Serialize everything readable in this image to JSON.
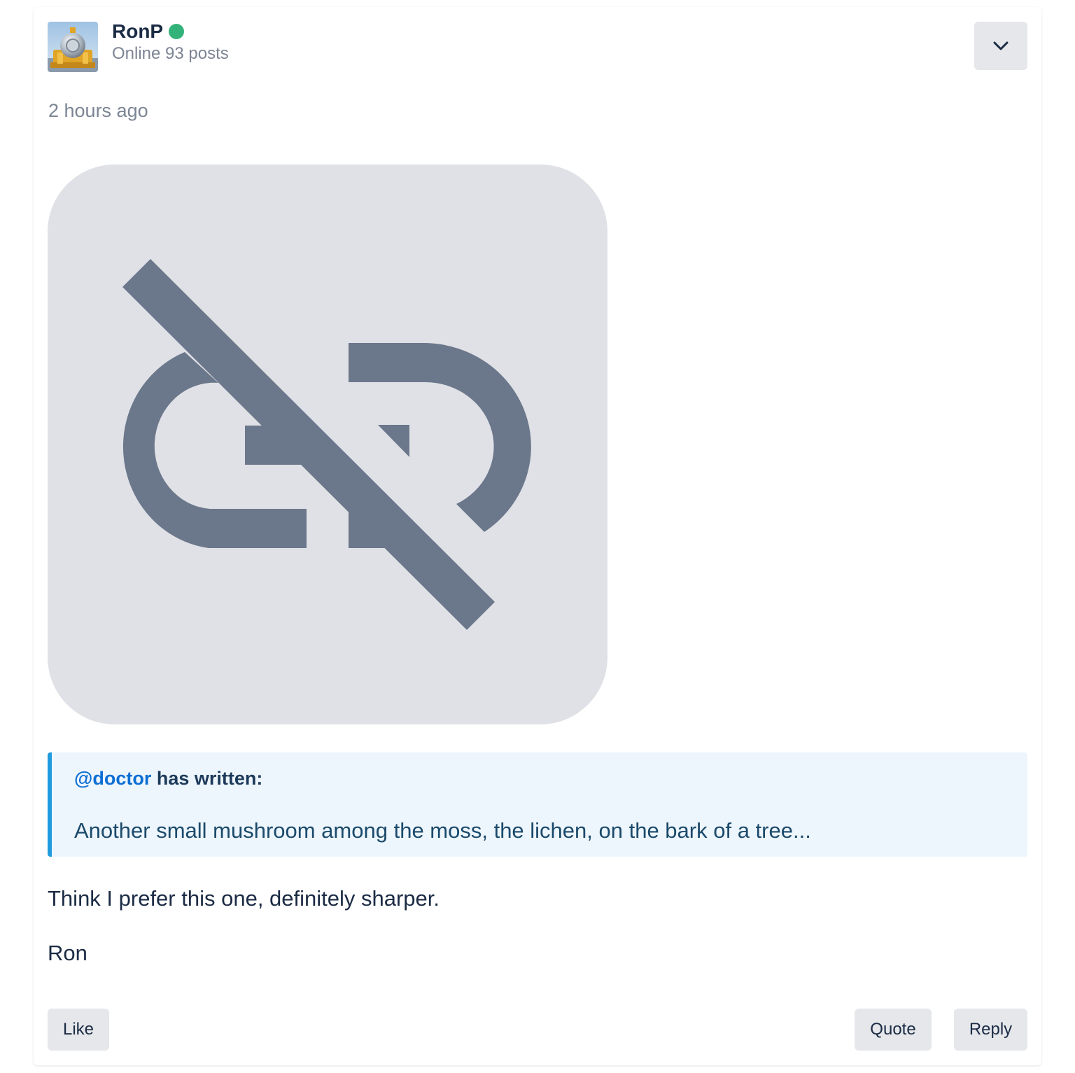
{
  "post": {
    "author": {
      "name": "RonP",
      "status": "Online",
      "posts": "93 posts",
      "avatar_icon": "user-avatar-image",
      "status_color": "#33b27a"
    },
    "timestamp": "2 hours ago",
    "image": {
      "icon": "broken-link-icon"
    },
    "quote": {
      "mention": "@doctor",
      "suffix": " has written:",
      "text": "Another small mushroom among the moss, the lichen, on the bark of a tree..."
    },
    "body": [
      "Think I prefer this one, definitely sharper.",
      "Ron"
    ],
    "actions": {
      "like": "Like",
      "quote": "Quote",
      "reply": "Reply"
    },
    "menu_icon": "chevron-down-icon"
  },
  "colors": {
    "accent_link": "#0d6fd3",
    "quote_bar": "#1f9bde",
    "button_bg": "#e5e7eb"
  }
}
